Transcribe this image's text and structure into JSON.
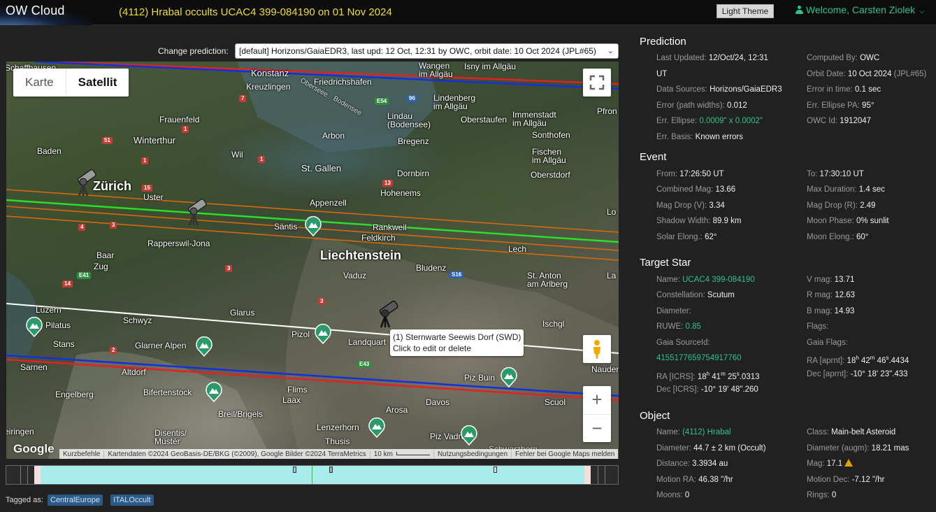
{
  "header": {
    "logo": "OW Cloud",
    "title": "(4112) Hrabal occults UCAC4 399-084190 on 01 Nov 2024",
    "theme_button": "Light Theme",
    "welcome": "Welcome, Carsten Ziolek"
  },
  "prediction_select": {
    "label": "Change prediction:",
    "value": "[default] Horizons/GaiaEDR3, last upd: 12 Oct, 12:31 by OWC, orbit date: 10 Oct 2024 (JPL#65)"
  },
  "map": {
    "type_karte": "Karte",
    "type_satellite": "Satellit",
    "zoom_in": "+",
    "zoom_out": "−",
    "tooltip_line1": "(1) Sternwarte Seewis Dorf (SWD)",
    "tooltip_line2": "Click to edit or delete",
    "google": "Google",
    "attribution": {
      "shortcuts": "Kurzbefehle",
      "data": "Kartendaten ©2024 GeoBasis-DE/BKG (©2009), Google Bilder ©2024 TerraMetrics",
      "scale": "10 km",
      "terms": "Nutzungsbedingungen",
      "report": "Fehler bei Google Maps melden"
    },
    "labels": {
      "schaffhausen": "Schaffhausen",
      "konstanz": "Konstanz",
      "kreuzlingen": "Kreuzlingen",
      "friedrichshafen": "Friedrichshafen",
      "oberseee": "Oberseee",
      "bodensee": "Bodensee",
      "wangen": "Wangen\nim Allgäu",
      "isny": "Isny im Allgäu",
      "lindenberg": "Lindenberg\nim Allgäu",
      "frauenfeld": "Frauenfeld",
      "lindau": "Lindau\n(Bodensee)",
      "oberstaufen": "Oberstaufen",
      "immenstadt": "Immenstadt\nim Allgäu",
      "sonthofen": "Sonthofen",
      "arbon": "Arbon",
      "bregenz": "Bregenz",
      "baden": "Baden",
      "winterthur": "Winterthur",
      "wil": "Wil",
      "fischen": "Fischen\nim Allgäu",
      "stgallen": "St. Gallen",
      "dornbirn": "Dornbirn",
      "oberstdorf": "Oberstdorf",
      "zurich": "Zürich",
      "hohenems": "Hohenems",
      "uster": "Uster",
      "appenzell": "Appenzell",
      "santis": "Säntis",
      "rankweil": "Rankweil",
      "feldkirch": "Feldkirch",
      "rapperswil": "Rapperswil-Jona",
      "lech": "Lech",
      "liechtenstein": "Liechtenstein",
      "bludenz": "Bludenz",
      "baar": "Baar",
      "zug": "Zug",
      "vaduz": "Vaduz",
      "stanton": "St. Anton\nam Arlberg",
      "luzern": "Luzern",
      "glarus": "Glarus",
      "schwyz": "Schwyz",
      "ischgl": "Ischgl",
      "pilatus": "Pilatus",
      "pizol": "Pizol",
      "landquart": "Landquart",
      "stans": "Stans",
      "glarneralpen": "Glarner Alpen",
      "sarnen": "Sarnen",
      "altdorf": "Altdorf",
      "piz_buin": "Piz Buin",
      "nauders": "Nauders",
      "engelberg": "Engelberg",
      "flims": "Flims",
      "laax": "Laax",
      "bifertenstock": "Bifertenstock",
      "davos": "Davos",
      "scuol": "Scuol",
      "arosa": "Arosa",
      "breil": "Breil/Brigels",
      "lenzerhorn": "Lenzerhorn",
      "disentis": "Disentis/\nMustér",
      "thusis": "Thusis",
      "piz_vadret": "Piz Vadret",
      "meiringen": "eiringen",
      "pfron": "Pfron",
      "lo": "Lo",
      "la": "La",
      "schwarzhorn": "Schwarzhorn"
    },
    "roads": [
      "7",
      "96",
      "E54",
      "1",
      "51",
      "1",
      "1",
      "13",
      "15",
      "4",
      "3",
      "E41",
      "14",
      "3",
      "S16",
      "3",
      "2",
      "E43"
    ]
  },
  "timeline": {},
  "tags": {
    "label": "Tagged as:",
    "items": [
      "CentralEurope",
      "ITALOccult"
    ]
  },
  "prediction": {
    "title": "Prediction",
    "last_updated_label": "Last Updated:",
    "last_updated": "12/Oct/24, 12:31",
    "last_updated_tz": "UT",
    "computed_by_label": "Computed By:",
    "computed_by": "OWC",
    "orbit_date_label": "Orbit Date:",
    "orbit_date": "10 Oct 2024",
    "orbit_date_extra": "(JPL#65)",
    "data_sources_label": "Data Sources:",
    "data_sources": "Horizons/GaiaEDR3",
    "error_in_time_label": "Error in time:",
    "error_in_time": "0.1 sec",
    "error_path_label": "Error (path widths):",
    "error_path": "0.012",
    "err_ellipse_pa_label": "Err. Ellipse PA:",
    "err_ellipse_pa": "95°",
    "err_ellipse_label": "Err. Ellipse:",
    "err_ellipse": "0.0009\" x 0.0002\"",
    "owc_id_label": "OWC Id:",
    "owc_id": "1912047",
    "err_basis_label": "Err. Basis:",
    "err_basis": "Known errors"
  },
  "event": {
    "title": "Event",
    "from_label": "From:",
    "from": "17:26:50 UT",
    "to_label": "To:",
    "to": "17:30:10 UT",
    "combined_mag_label": "Combined Mag:",
    "combined_mag": "13.66",
    "max_duration_label": "Max Duration:",
    "max_duration": "1.4 sec",
    "mag_drop_v_label": "Mag Drop (V):",
    "mag_drop_v": "3.34",
    "mag_drop_r_label": "Mag Drop (R):",
    "mag_drop_r": "2.49",
    "shadow_width_label": "Shadow Width:",
    "shadow_width": "89.9 km",
    "moon_phase_label": "Moon Phase:",
    "moon_phase": "0% sunlit",
    "solar_elong_label": "Solar Elong.:",
    "solar_elong": "62°",
    "moon_elong_label": "Moon Elong.:",
    "moon_elong": "60°"
  },
  "target_star": {
    "title": "Target Star",
    "name_label": "Name:",
    "name": "UCAC4 399-084190",
    "vmag_label": "V mag:",
    "vmag": "13.71",
    "constellation_label": "Constellation:",
    "constellation": "Scutum",
    "rmag_label": "R mag:",
    "rmag": "12.63",
    "diameter_label": "Diameter:",
    "bmag_label": "B mag:",
    "bmag": "14.93",
    "ruwe_label": "RUWE:",
    "ruwe": "0.85",
    "flags_label": "Flags:",
    "gaia_source_label": "Gaia SourceId:",
    "gaia_source": "4155177659754917760",
    "gaia_flags_label": "Gaia Flags:",
    "ra_icrs_label": "RA [ICRS]:",
    "ra_icrs_h": "18",
    "ra_icrs_m": "41",
    "ra_icrs_s": "25",
    "ra_icrs_frac": ".0313",
    "dec_icrs_label": "Dec [ICRS]:",
    "dec_icrs_d": "-10°",
    "dec_icrs_m": "19'",
    "dec_icrs_s": "48\"",
    "dec_icrs_frac": ".260",
    "ra_aprnt_label": "RA [aprnt]:",
    "ra_aprnt_h": "18",
    "ra_aprnt_m": "42",
    "ra_aprnt_s": "46",
    "ra_aprnt_frac": ".4434",
    "dec_aprnt_label": "Dec [aprnt]:",
    "dec_aprnt_d": "-10°",
    "dec_aprnt_m": "18'",
    "dec_aprnt_s": "23\"",
    "dec_aprnt_frac": ".433",
    "unit_h": "h",
    "unit_m": "m",
    "unit_s": "s"
  },
  "object": {
    "title": "Object",
    "name_label": "Name:",
    "name": "(4112) Hrabal",
    "class_label": "Class:",
    "class": "Main-belt Asteroid",
    "diameter_label": "Diameter:",
    "diameter": "44.7 ± 2 km",
    "diameter_note": "(Occult)",
    "diameter_augm_label": "Diameter (augm):",
    "diameter_augm": "18.21 mas",
    "distance_label": "Distance:",
    "distance": "3.3934 au",
    "mag_label": "Mag:",
    "mag": "17.1",
    "motion_ra_label": "Motion RA:",
    "motion_ra": "46.38 \"/hr",
    "motion_dec_label": "Motion Dec:",
    "motion_dec": "-7.12 \"/hr",
    "moons_label": "Moons:",
    "moons": "0",
    "rings_label": "Rings:",
    "rings": "0"
  }
}
